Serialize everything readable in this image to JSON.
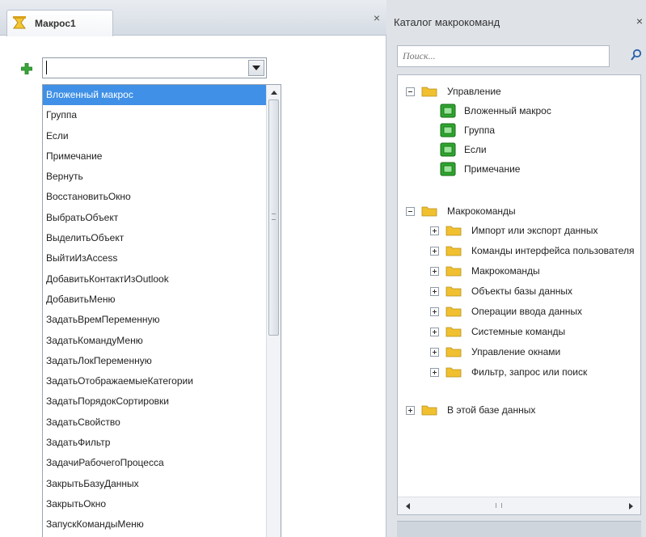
{
  "document_tab": {
    "title": "Макрос1",
    "icon": "macro-object-icon",
    "close_label": "×"
  },
  "editor": {
    "add_action_icon": "green-plus-icon",
    "combo_value": "",
    "dropdown_arrow_icon": "triangle-down-icon",
    "actions": [
      "Вложенный макрос",
      "Группа",
      "Если",
      "Примечание",
      "Вернуть",
      "ВосстановитьОкно",
      "ВыбратьОбъект",
      "ВыделитьОбъект",
      "ВыйтиИзAccess",
      "ДобавитьКонтактИзOutlook",
      "ДобавитьМеню",
      "ЗадатьВремПеременную",
      "ЗадатьКомандуМеню",
      "ЗадатьЛокПеременную",
      "ЗадатьОтображаемыеКатегории",
      "ЗадатьПорядокСортировки",
      "ЗадатьСвойство",
      "ЗадатьФильтр",
      "ЗадачиРабочегоПроцесса",
      "ЗакрытьБазуДанных",
      "ЗакрытьОкно",
      "ЗапускКомандыМеню"
    ],
    "selected_index": 0
  },
  "catalog": {
    "title": "Каталог макрокоманд",
    "close_label": "×",
    "search_placeholder": "Поиск...",
    "search_icon": "search-icon",
    "tree": {
      "control_flow": {
        "label": "Управление",
        "expander": "⊟",
        "items": [
          "Вложенный макрос",
          "Группа",
          "Если",
          "Примечание"
        ]
      },
      "actions": {
        "label": "Макрокоманды",
        "expander": "⊟",
        "groups": [
          "Импорт или экспорт данных",
          "Команды интерфейса пользователя",
          "Макрокоманды",
          "Объекты базы данных",
          "Операции ввода данных",
          "Системные команды",
          "Управление окнами",
          "Фильтр, запрос или поиск"
        ]
      },
      "in_this_database": {
        "label": "В этой базе данных",
        "expander": "⊞"
      }
    }
  },
  "colors": {
    "selection": "#3f90e6",
    "folder": "#f0c030",
    "macro_green": "#2fa52f"
  }
}
